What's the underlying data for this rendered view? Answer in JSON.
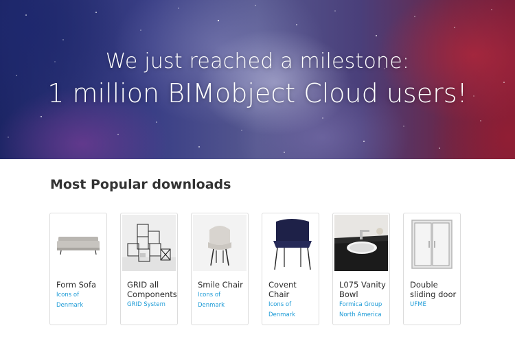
{
  "hero": {
    "line1": "We just reached a milestone:",
    "line2": "1 million BIMobject Cloud users!"
  },
  "section": {
    "title": "Most Popular downloads"
  },
  "products": [
    {
      "name": "Form Sofa",
      "brand": "Icons of Denmark",
      "image": "sofa-image"
    },
    {
      "name": "GRID all Components",
      "brand": "GRID System",
      "image": "grid-shelving-image"
    },
    {
      "name": "Smile Chair",
      "brand": "Icons of Denmark",
      "image": "chair-image"
    },
    {
      "name": "Covent Chair",
      "brand": "Icons of Denmark",
      "image": "chair-image"
    },
    {
      "name": "L075 Vanity Bowl",
      "brand": "Formica Group North America",
      "image": "vanity-bowl-image"
    },
    {
      "name": "Double sliding door",
      "brand": "UFME",
      "image": "sliding-door-image"
    }
  ],
  "colors": {
    "link": "#1a9ad6",
    "title": "#333333",
    "card_border": "#dcdcdc"
  }
}
